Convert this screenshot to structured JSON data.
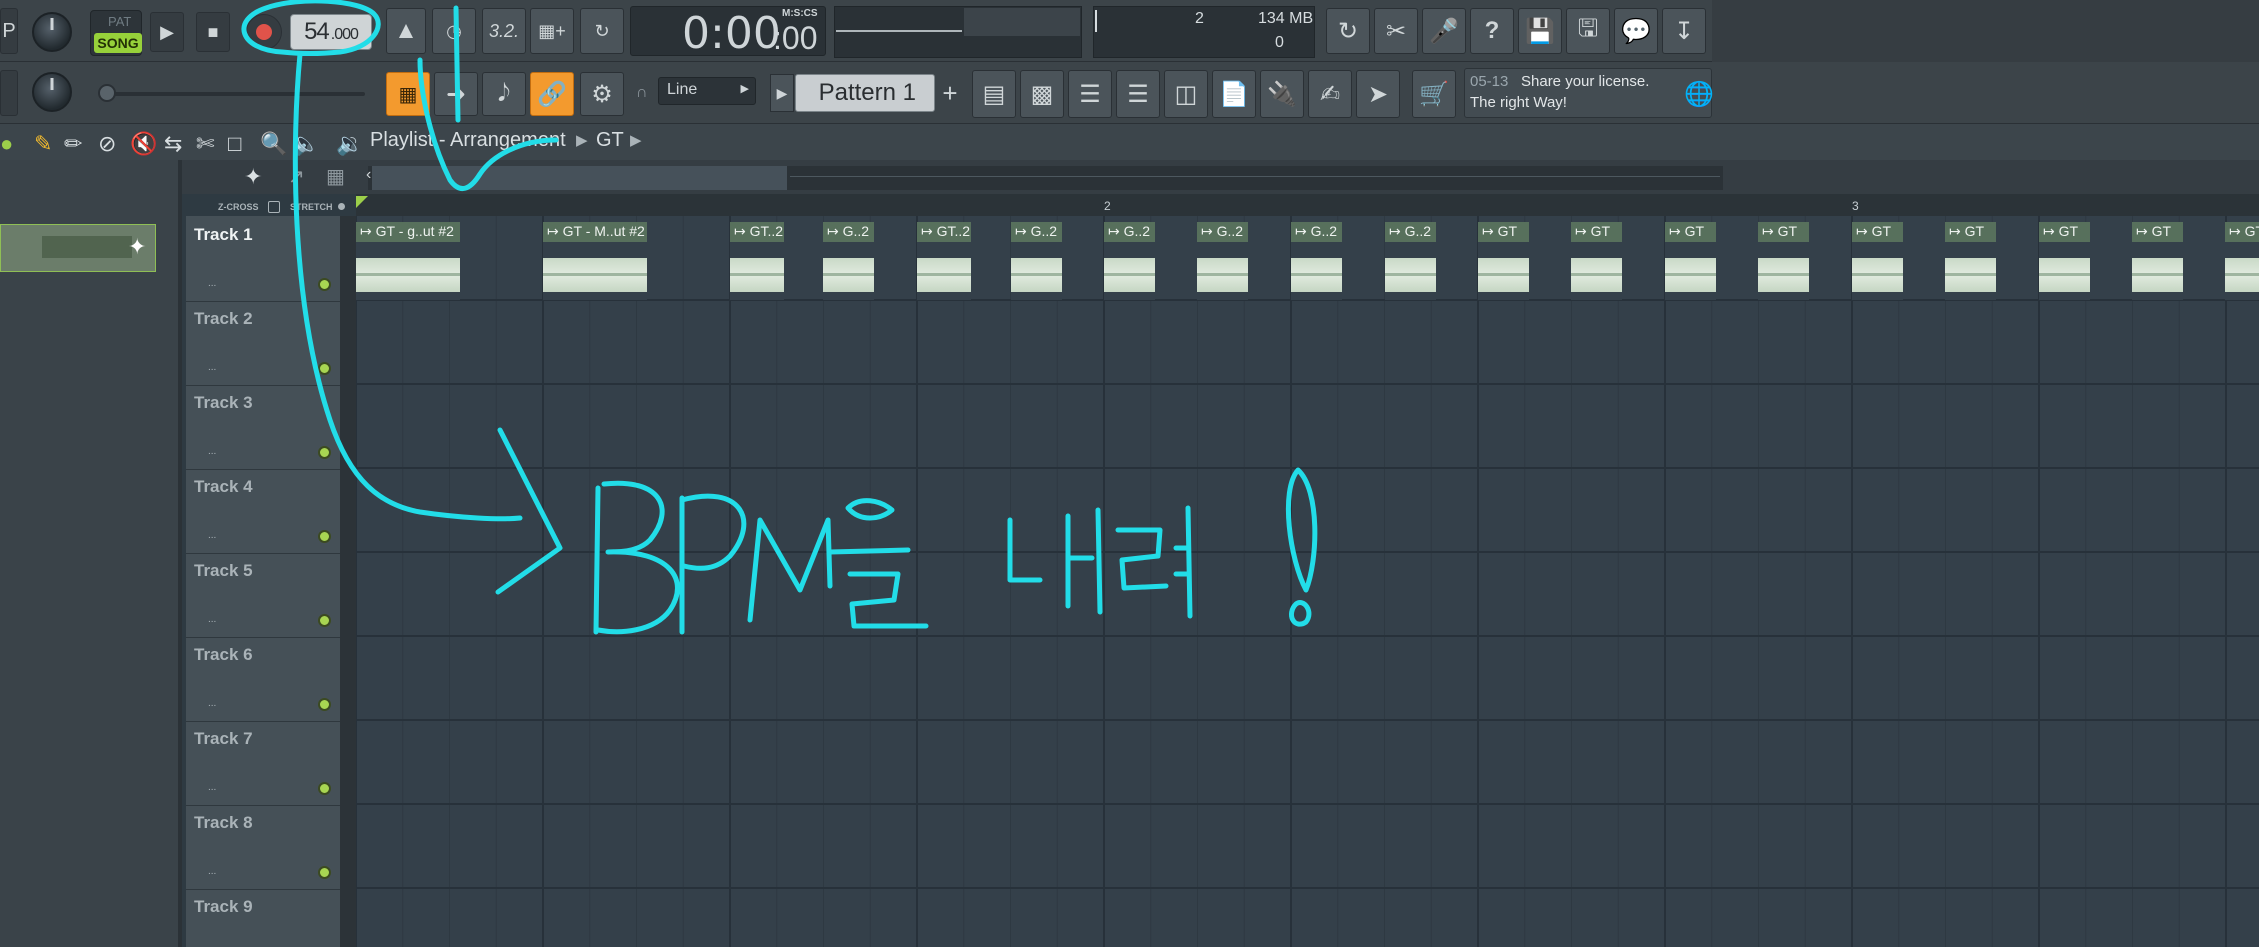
{
  "transport": {
    "pat_label": "PAT",
    "song_label": "SONG",
    "tempo_value": "54",
    "tempo_decimals": ".000",
    "time_main": "0:00",
    "time_cs": ":00",
    "time_format": "M:S:CS"
  },
  "status": {
    "cpu": "2",
    "memory": "134 MB",
    "polyphony": "0"
  },
  "snap": {
    "value": "Line"
  },
  "pattern": {
    "name": "Pattern 1"
  },
  "hint": {
    "date": "05-13",
    "line1": "Share your license.",
    "line2": "The right Way!"
  },
  "playlist": {
    "title": "Playlist - Arrangement",
    "breadcrumb": "GT",
    "zcross_label": "Z-CROSS",
    "stretch_label": "STRETCH",
    "ruler": [
      "2",
      "3"
    ]
  },
  "tracks": [
    "Track 1",
    "Track 2",
    "Track 3",
    "Track 4",
    "Track 5",
    "Track 6",
    "Track 7",
    "Track 8",
    "Track 9"
  ],
  "clips": [
    {
      "label": "GT - g..ut #2"
    },
    {
      "label": "GT - M..ut #2"
    },
    {
      "label": "GT..2"
    },
    {
      "label": "G..2"
    },
    {
      "label": "GT..2"
    },
    {
      "label": "G..2"
    },
    {
      "label": "G..2"
    },
    {
      "label": "G..2"
    },
    {
      "label": "G..2"
    },
    {
      "label": "G..2"
    },
    {
      "label": "GT"
    },
    {
      "label": "GT"
    },
    {
      "label": "GT"
    },
    {
      "label": "GT"
    },
    {
      "label": "GT"
    },
    {
      "label": "GT"
    },
    {
      "label": "GT"
    },
    {
      "label": "GT"
    },
    {
      "label": "GT"
    }
  ],
  "annotation": {
    "text": "BPM을 내려!",
    "color": "#22dde8"
  },
  "icons": [
    "record-icon",
    "play-icon",
    "stop-icon",
    "metronome-icon",
    "undo-icon",
    "cut-icon",
    "mic-icon",
    "help-icon",
    "save-icon",
    "chat-icon",
    "download-icon",
    "pencil-icon",
    "paint-icon",
    "delete-icon",
    "mute-icon",
    "slip-icon",
    "select-icon",
    "zoom-icon",
    "playback-icon",
    "speaker-icon"
  ]
}
